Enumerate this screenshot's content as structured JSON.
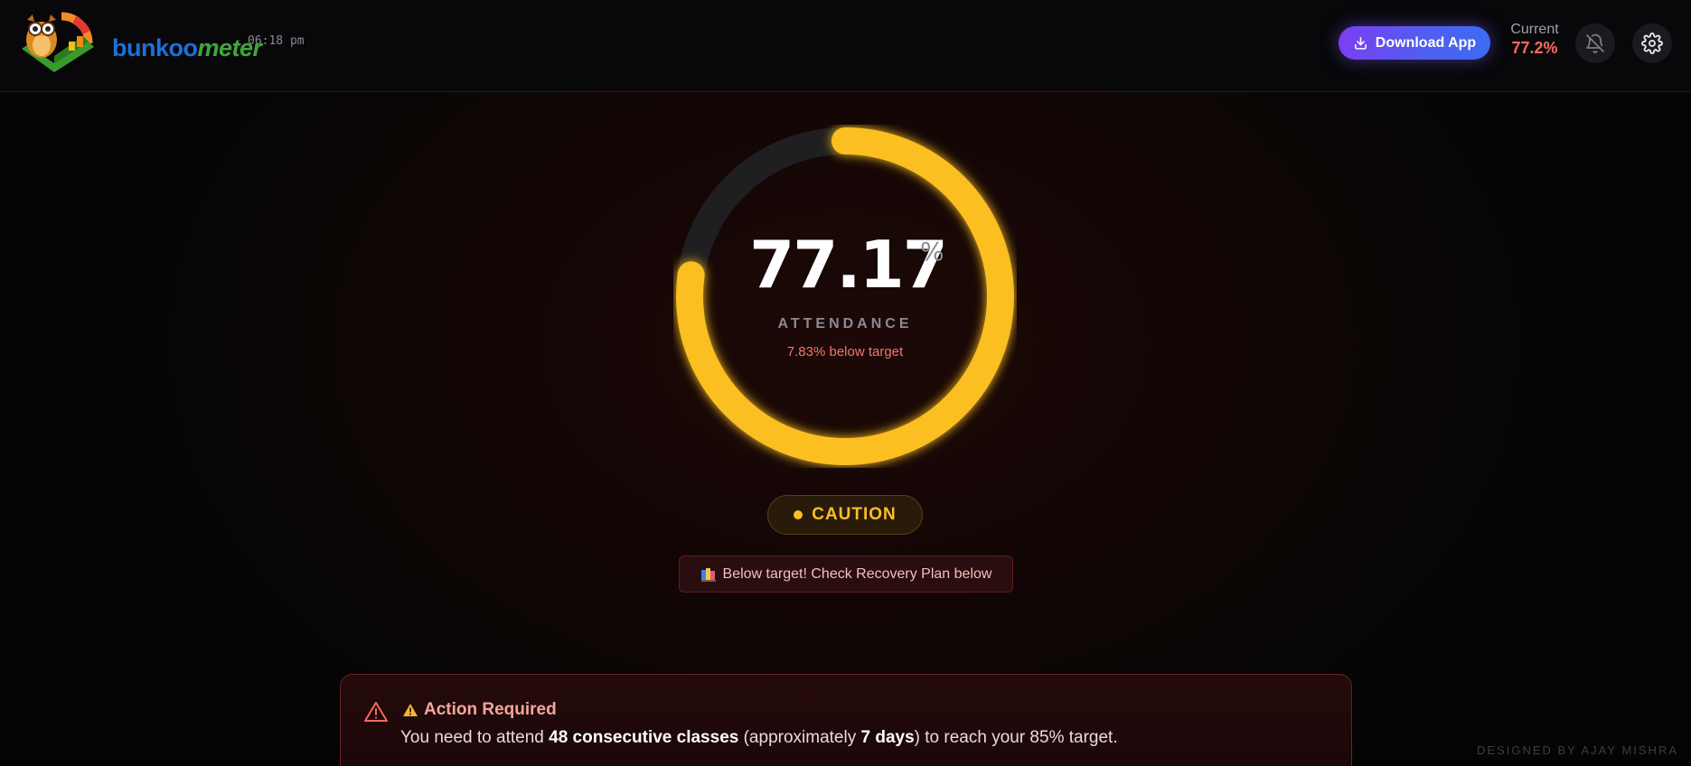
{
  "header": {
    "logo_text_part1": "bunkoo",
    "logo_text_part2": "meter",
    "clock": "06:18 pm",
    "download_label": "Download App",
    "current_label": "Current",
    "current_value": "77.2%"
  },
  "gauge": {
    "value": "77.17",
    "percent_sign": "%",
    "progress_fraction": 0.7717,
    "label": "ATTENDANCE",
    "below_target": "7.83% below target",
    "accent_color": "#fbbf24",
    "track_color": "#1f1f22"
  },
  "status": {
    "badge": "CAUTION",
    "hint": "Below target! Check Recovery Plan below"
  },
  "action": {
    "title": "Action Required",
    "text_1": "You need to attend ",
    "classes": "48 consecutive classes",
    "text_2": " (approximately ",
    "days": "7 days",
    "text_3": ") to reach your 85% target."
  },
  "footer": {
    "credit": "DESIGNED BY AJAY MISHRA"
  },
  "icons": {
    "download": "download-icon",
    "bell": "bell-off-icon",
    "settings": "gear-icon",
    "warning": "warning-triangle-icon",
    "books": "books-icon"
  }
}
